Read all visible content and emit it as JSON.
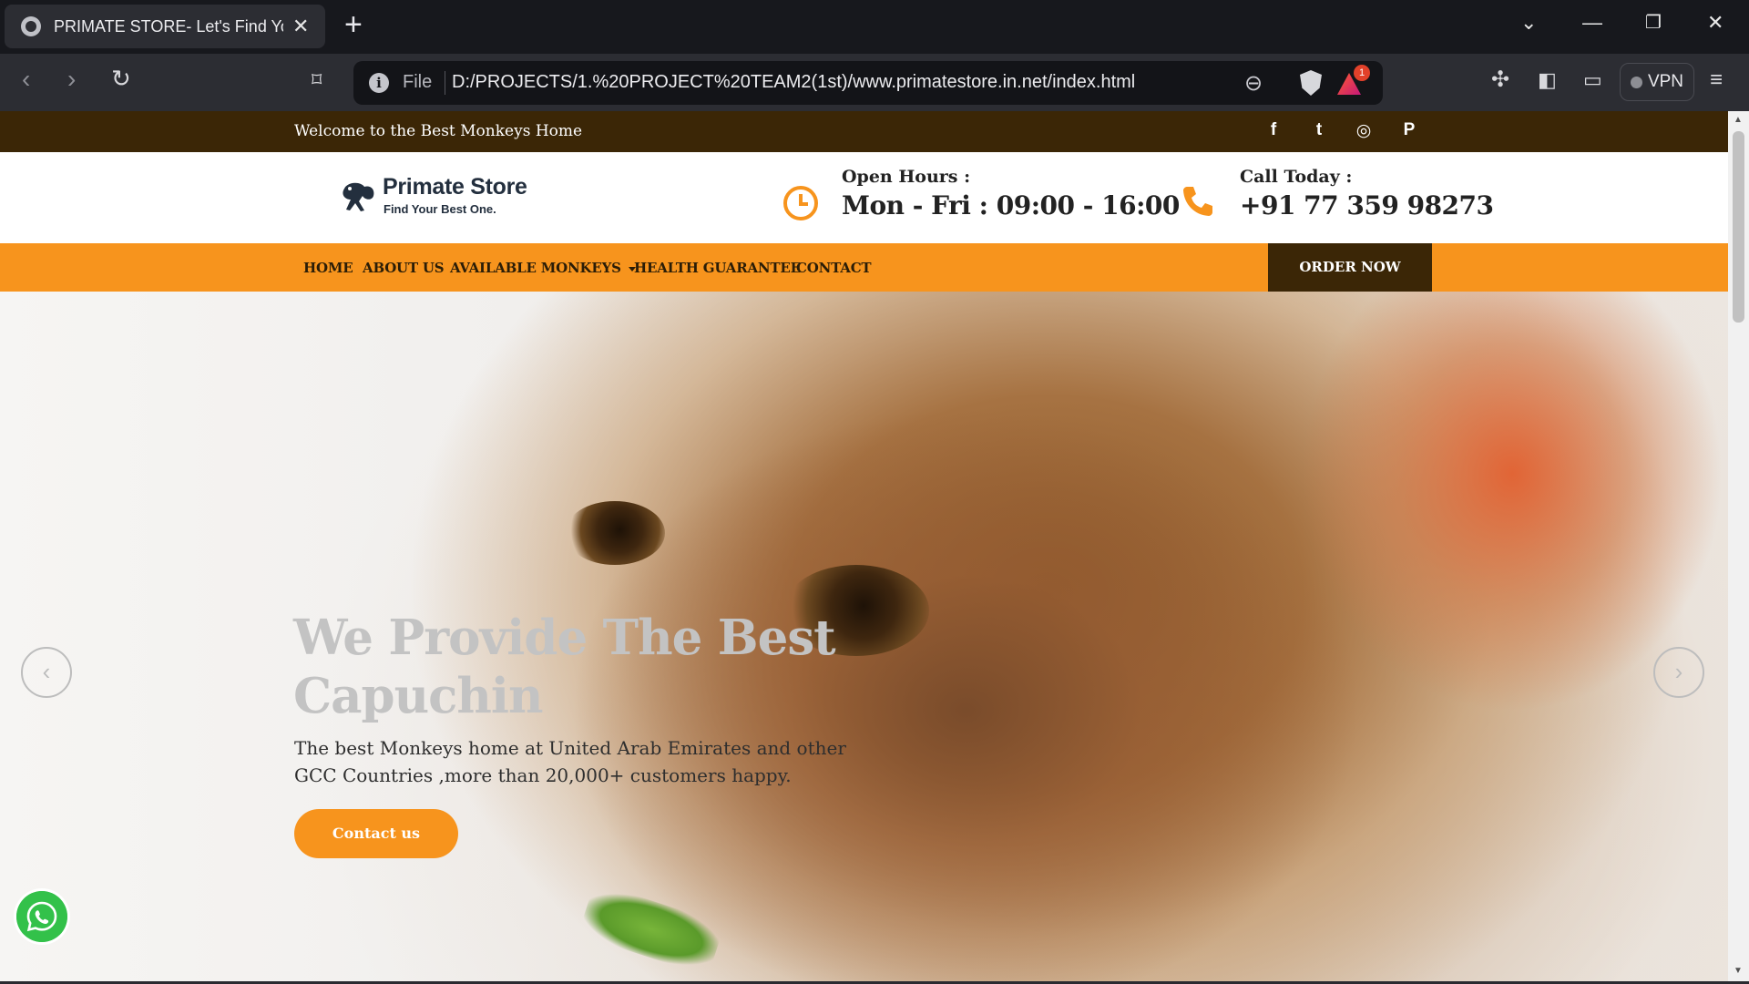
{
  "browser": {
    "tab_title": "PRIMATE STORE- Let's Find Your",
    "new_tab": "+",
    "url_scheme": "File",
    "url": "D:/PROJECTS/1.%20PROJECT%20TEAM2(1st)/www.primatestore.in.net/index.html",
    "rewards_count": "1",
    "vpn_label": "VPN"
  },
  "topbar": {
    "welcome": "Welcome to the Best Monkeys Home",
    "social_icons": [
      "facebook-icon",
      "twitter-icon",
      "instagram-icon",
      "pinterest-icon"
    ],
    "social_glyphs": [
      "f",
      "t",
      "◎",
      "P"
    ]
  },
  "header": {
    "logo_title": "Primate Store",
    "logo_subtitle": "Find Your Best One.",
    "hours_label": "Open Hours :",
    "hours_value": "Mon - Fri : 09:00 - 16:00",
    "call_label": "Call Today :",
    "call_value": "+91 77 359 98273"
  },
  "nav": {
    "items": [
      {
        "label": "HOME"
      },
      {
        "label": "ABOUT US"
      },
      {
        "label": "AVAILABLE MONKEYS"
      },
      {
        "label": "HEALTH GUARANTEE"
      },
      {
        "label": "CONTACT"
      }
    ],
    "order_label": "ORDER NOW"
  },
  "hero": {
    "title": "We Provide The Best Capuchin",
    "text": "The best Monkeys home at United Arab Emirates and other GCC Countries ,more than 20,000+ customers happy.",
    "button": "Contact us",
    "prev": "‹",
    "next": "›"
  },
  "colors": {
    "accent": "#f7941d",
    "dark_brown": "#3b2606",
    "logo_navy": "#232f3e",
    "whatsapp_green": "#33c14a"
  }
}
